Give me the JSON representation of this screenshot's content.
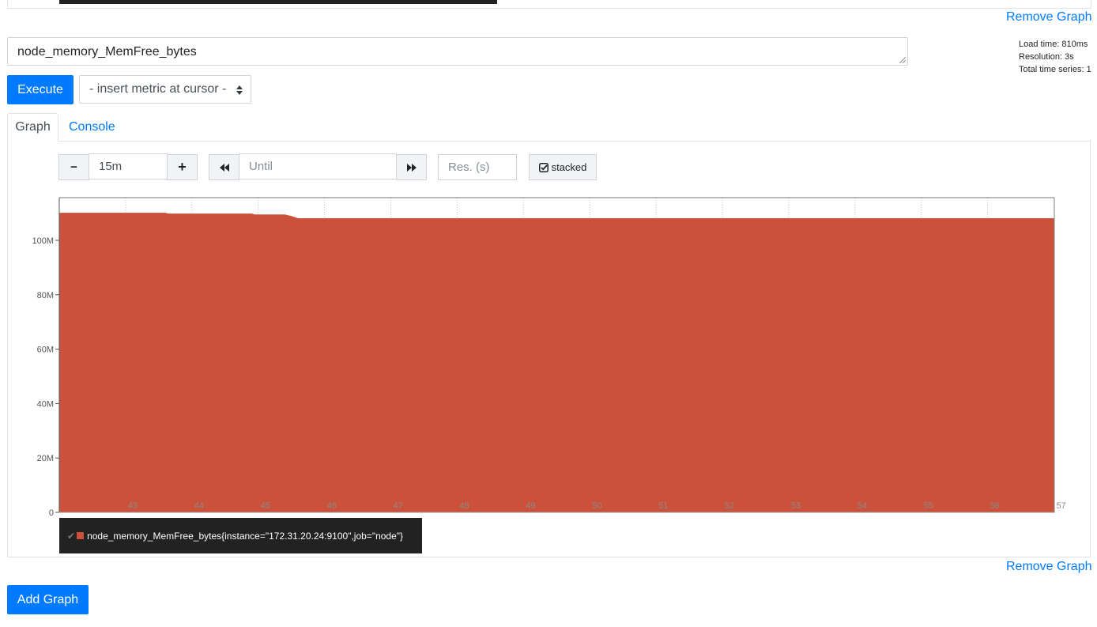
{
  "previous_graph": {
    "remove_label": "Remove Graph"
  },
  "query": {
    "expression": "node_memory_MemFree_bytes",
    "execute_label": "Execute",
    "metric_select": "- insert metric at cursor -"
  },
  "stats": {
    "load_time": "Load time: 810ms",
    "resolution": "Resolution: 3s",
    "total_series": "Total time series: 1"
  },
  "tabs": {
    "graph": "Graph",
    "console": "Console"
  },
  "controls": {
    "minus": "−",
    "range": "15m",
    "plus": "+",
    "until_placeholder": "Until",
    "res_placeholder": "Res. (s)",
    "stacked_label": "stacked"
  },
  "chart_data": {
    "type": "area",
    "stacked": true,
    "grid": true,
    "y_ticks": [
      "0",
      "20M",
      "40M",
      "60M",
      "80M",
      "100M"
    ],
    "ylim": [
      0,
      115000000
    ],
    "x_ticks": [
      "43",
      "44",
      "45",
      "46",
      "47",
      "48",
      "49",
      "50",
      "51",
      "52",
      "53",
      "54",
      "55",
      "56",
      "57"
    ],
    "xlim": [
      42,
      57
    ],
    "series": [
      {
        "name": "node_memory_MemFree_bytes{instance=\"172.31.20.24:9100\",job=\"node\"}",
        "color": "#cb513a",
        "x": [
          42,
          43.6,
          43.65,
          44.9,
          44.95,
          45.4,
          45.5,
          45.6,
          57
        ],
        "y": [
          110000000,
          110000000,
          109700000,
          109700000,
          109400000,
          109400000,
          108800000,
          108000000,
          108000000
        ]
      }
    ]
  },
  "legend": {
    "check": "✔",
    "label": "node_memory_MemFree_bytes{instance=\"172.31.20.24:9100\",job=\"node\"}"
  },
  "bottom": {
    "remove_label": "Remove Graph",
    "add_label": "Add Graph"
  }
}
